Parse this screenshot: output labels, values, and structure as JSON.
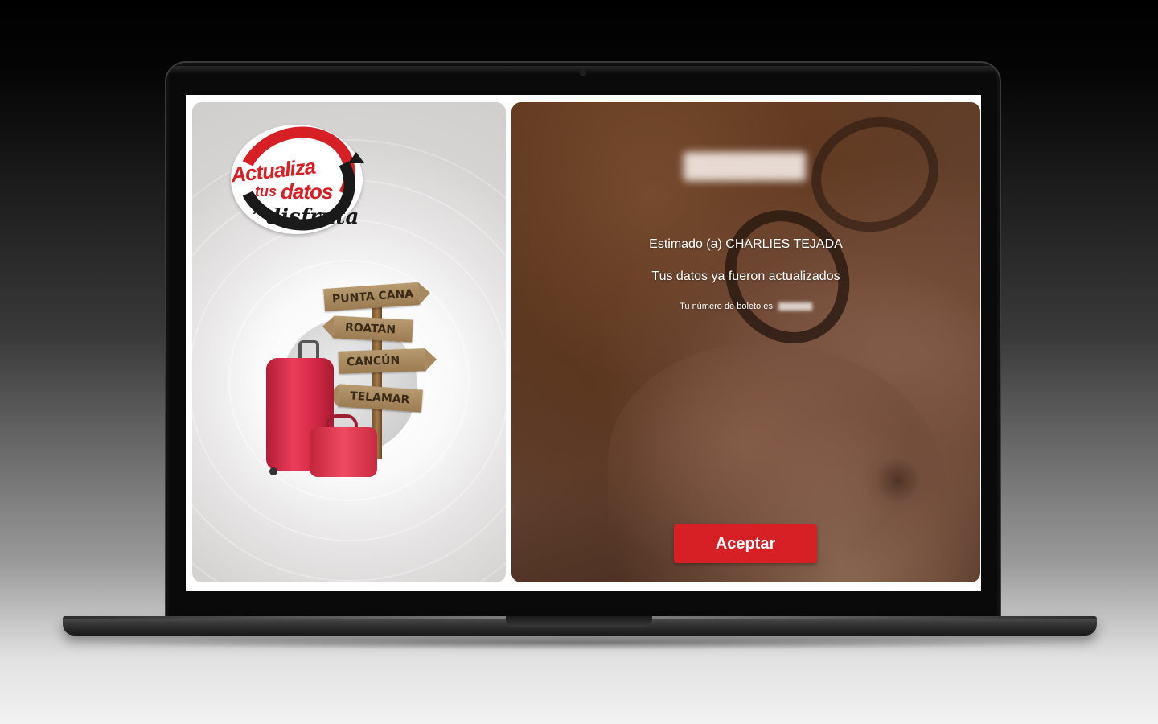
{
  "logo": {
    "line1": "Actualiza",
    "line2": "tus",
    "line3": "datos",
    "line4": "y",
    "line5": "disfruta"
  },
  "destinations": [
    "PUNTA CANA",
    "ROATÁN",
    "CANCÚN",
    "TELAMAR"
  ],
  "message": {
    "greeting": "Estimado (a) CHARLIES TEJADA",
    "status": "Tus datos ya fueron actualizados",
    "ticket_label": "Tu número de boleto es:"
  },
  "accept_button": "Aceptar",
  "colors": {
    "brand_red": "#d71f26",
    "text": "#ffffff"
  }
}
